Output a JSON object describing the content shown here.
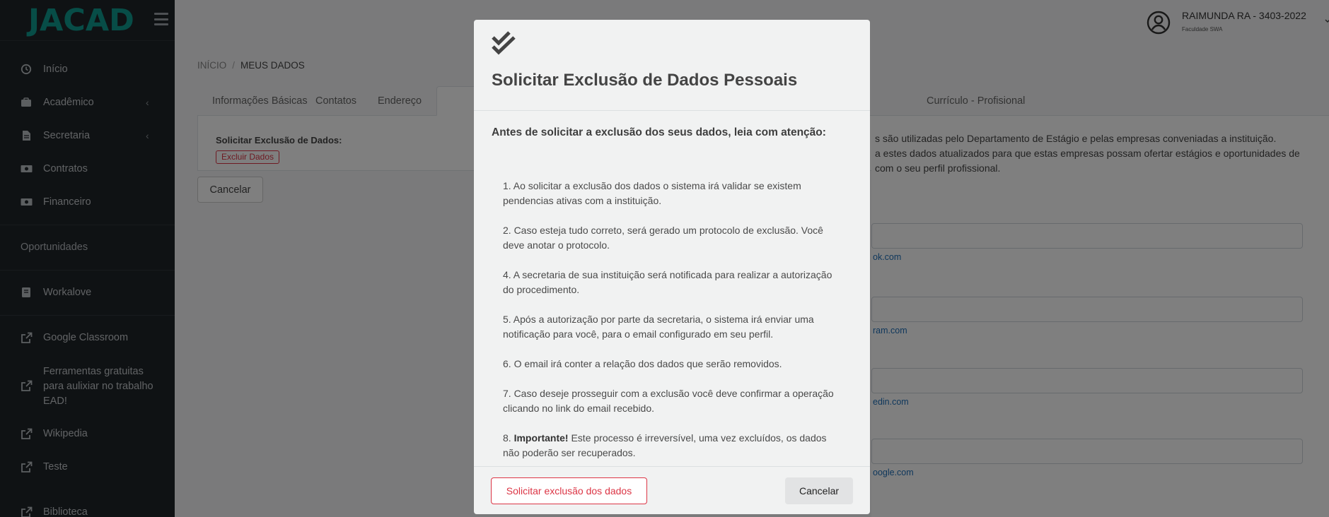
{
  "app": {
    "logo_text": "JACAD"
  },
  "sidebar": {
    "items": [
      {
        "label": "Início",
        "icon": "home-icon"
      },
      {
        "label": "Acadêmico",
        "icon": "academic-icon",
        "has_submenu": true
      },
      {
        "label": "Secretaria",
        "icon": "secretaria-icon",
        "has_submenu": true
      },
      {
        "label": "Contratos",
        "icon": "money-icon"
      },
      {
        "label": "Financeiro",
        "icon": "money-icon"
      }
    ],
    "section_oportunidades": "Oportunidades",
    "workalove": "Workalove",
    "links": [
      {
        "label": "Google Classroom",
        "icon": "external-link-icon"
      },
      {
        "label": "Ferramentas gratuitas para aulixiar no trabalho EAD!",
        "icon": "external-link-icon"
      },
      {
        "label": "Wikipedia",
        "icon": "external-link-icon"
      },
      {
        "label": "Teste",
        "icon": "external-link-icon"
      },
      {
        "label": "Biblioteca",
        "icon": "external-link-icon"
      }
    ]
  },
  "header": {
    "user_name": "RAIMUNDA RA - 3403-2022",
    "user_institution": "Faculdade SWA"
  },
  "breadcrumb": {
    "home": "INÍCIO",
    "separator": "/",
    "current": "MEUS DADOS"
  },
  "tabs": {
    "basic": "Informações Básicas",
    "contacts": "Contatos",
    "address": "Endereço",
    "curriculum": "Currículo - Profisional"
  },
  "card": {
    "label": "Solicitar Exclusão de Dados:",
    "delete_button": "Excluir Dados"
  },
  "main_cancel": "Cancelar",
  "right_panel": {
    "text_line1": "s são utilizadas pelo Departamento de Estágio e pelas empresas conveniadas a instituição.",
    "text_line2": "a estes dados atualizados para que estas empresas possam ofertar estágios e oportunidades de",
    "text_line3": "com o seu perfil profissional.",
    "hints": [
      "ok.com",
      "ram.com",
      "edin.com",
      "oogle.com"
    ]
  },
  "modal": {
    "icon": "double-check-icon",
    "title": "Solicitar Exclusão de Dados Pessoais",
    "lead": "Antes de solicitar a exclusão dos seus dados, leia com atenção:",
    "rules": [
      {
        "text": "1. Ao solicitar a exclusão dos dados o sistema irá validar se existem pendencias ativas com a instituição."
      },
      {
        "text": "2. Caso esteja tudo correto, será gerado um protocolo de exclusão. Você deve anotar o protocolo."
      },
      {
        "text": "4. A secretaria de sua instituição será notificada para realizar a autorização do procedimento."
      },
      {
        "text": "5. Após a autorização por parte da secretaria, o sistema irá enviar uma notificação para você, para o email configurado em seu perfil."
      },
      {
        "text": "6. O email irá conter a relação dos dados que serão removidos."
      },
      {
        "text": "7. Caso deseje prosseguir com a exclusão você deve confirmar a operação clicando no link do email recebido."
      }
    ],
    "rule8_prefix": "8. ",
    "rule8_bold": "Importante!",
    "rule8_rest": " Este processo é irreversível, uma vez excluídos, os dados não poderão ser recuperados.",
    "confirm_button": "Solicitar exclusão dos dados",
    "cancel_button": "Cancelar"
  },
  "colors": {
    "brand": "#0f9a8f",
    "danger": "#dc3545",
    "sidebar_bg": "#1f2428"
  }
}
